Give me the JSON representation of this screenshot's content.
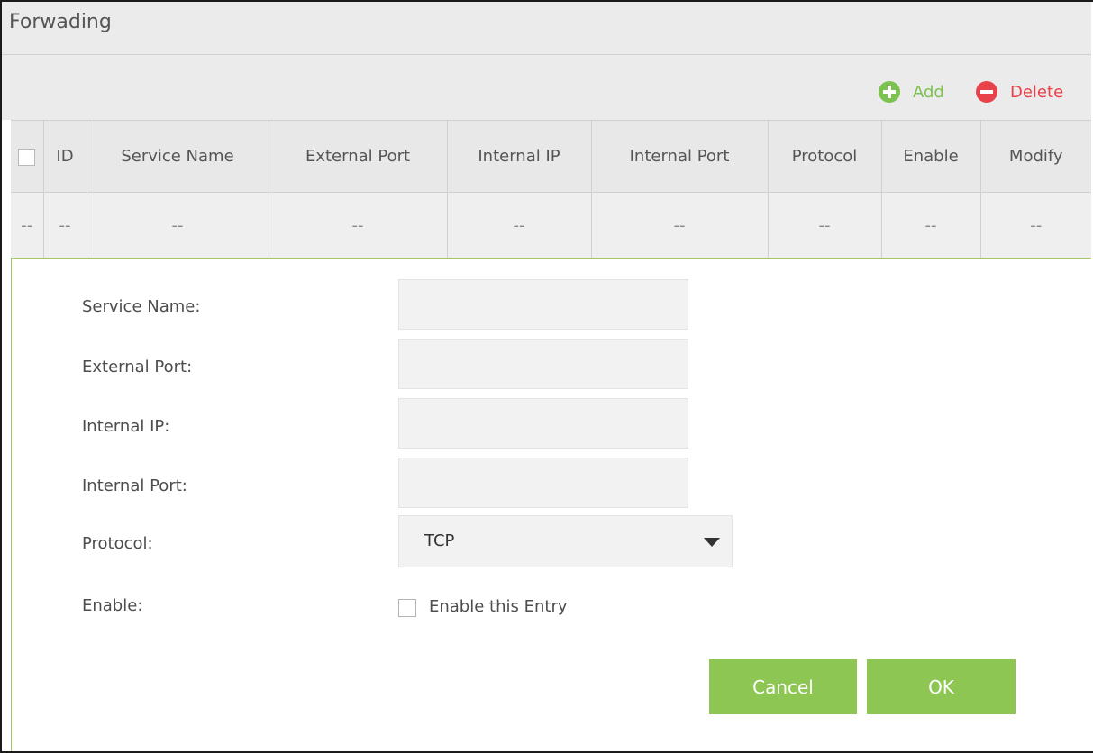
{
  "header": {
    "title": "Forwading"
  },
  "toolbar": {
    "add_label": "Add",
    "delete_label": "Delete",
    "add_color": "#7cc24f",
    "delete_color": "#e8424a"
  },
  "table": {
    "columns": [
      "ID",
      "Service Name",
      "External Port",
      "Internal IP",
      "Internal Port",
      "Protocol",
      "Enable",
      "Modify"
    ],
    "empty_row": [
      "--",
      "--",
      "--",
      "--",
      "--",
      "--",
      "--",
      "--",
      "--"
    ]
  },
  "form": {
    "service_name_label": "Service Name:",
    "external_port_label": "External Port:",
    "internal_ip_label": "Internal IP:",
    "internal_port_label": "Internal Port:",
    "protocol_label": "Protocol:",
    "protocol_value": "TCP",
    "enable_label": "Enable:",
    "enable_checkbox_text": "Enable this Entry",
    "service_name_value": "",
    "external_port_value": "",
    "internal_ip_value": "",
    "internal_port_value": "",
    "enable_checked": false
  },
  "buttons": {
    "cancel": "Cancel",
    "ok": "OK",
    "color": "#8dc653"
  }
}
